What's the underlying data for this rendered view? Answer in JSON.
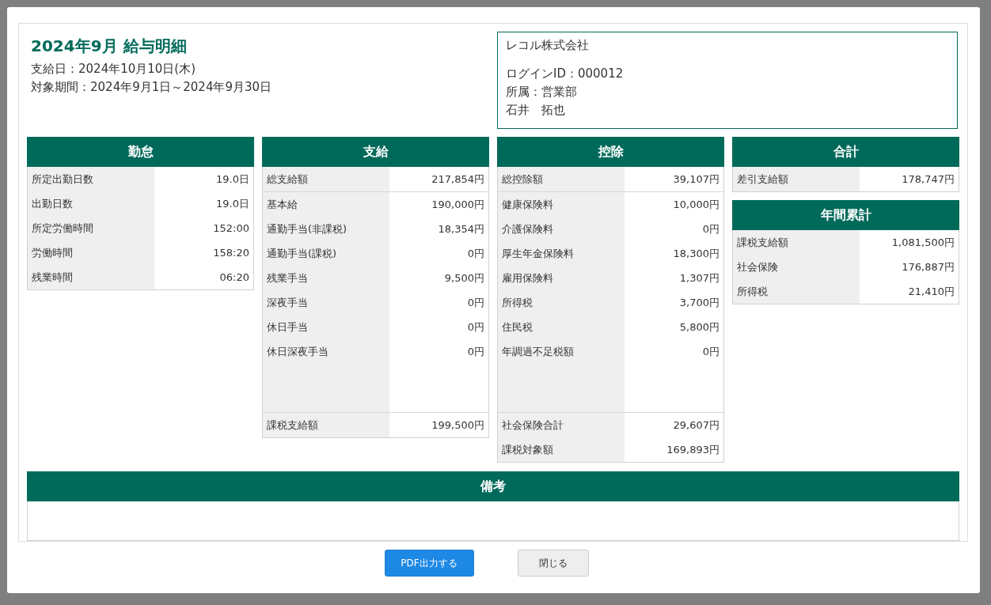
{
  "title": "2024年9月 給与明細",
  "pay_date": "支給日：2024年10月10日(木)",
  "period": "対象期間：2024年9月1日～2024年9月30日",
  "employee": {
    "company": "レコル株式会社",
    "login_id": "ログインID：000012",
    "department": "所属：営業部",
    "name": "石井　拓也"
  },
  "columns": [
    [
      {
        "title": "勤怠",
        "groups": [
          [
            {
              "label": "所定出勤日数",
              "value": "19.0日"
            },
            {
              "label": "出勤日数",
              "value": "19.0日"
            },
            {
              "label": "所定労働時間",
              "value": "152:00"
            },
            {
              "label": "労働時間",
              "value": "158:20"
            },
            {
              "label": "残業時間",
              "value": "06:20"
            }
          ]
        ]
      }
    ],
    [
      {
        "title": "支給",
        "groups": [
          [
            {
              "label": "総支給額",
              "value": "217,854円"
            }
          ],
          [
            {
              "label": "基本給",
              "value": "190,000円"
            },
            {
              "label": "通勤手当(非課税)",
              "value": "18,354円"
            },
            {
              "label": "通勤手当(課税)",
              "value": "0円"
            },
            {
              "label": "残業手当",
              "value": "9,500円"
            },
            {
              "label": "深夜手当",
              "value": "0円"
            },
            {
              "label": "休日手当",
              "value": "0円"
            },
            {
              "label": "休日深夜手当",
              "value": "0円"
            }
          ],
          [
            {
              "label": "課税支給額",
              "value": "199,500円"
            }
          ]
        ]
      }
    ],
    [
      {
        "title": "控除",
        "groups": [
          [
            {
              "label": "総控除額",
              "value": "39,107円"
            }
          ],
          [
            {
              "label": "健康保険料",
              "value": "10,000円"
            },
            {
              "label": "介護保険料",
              "value": "0円"
            },
            {
              "label": "厚生年金保険料",
              "value": "18,300円"
            },
            {
              "label": "雇用保険料",
              "value": "1,307円"
            },
            {
              "label": "所得税",
              "value": "3,700円"
            },
            {
              "label": "住民税",
              "value": "5,800円"
            },
            {
              "label": "年調過不足税額",
              "value": "0円"
            }
          ],
          [
            {
              "label": "社会保険合計",
              "value": "29,607円"
            },
            {
              "label": "課税対象額",
              "value": "169,893円"
            }
          ]
        ]
      }
    ],
    [
      {
        "title": "合計",
        "groups": [
          [
            {
              "label": "差引支給額",
              "value": "178,747円"
            }
          ]
        ]
      },
      {
        "title": "年間累計",
        "groups": [
          [
            {
              "label": "課税支給額",
              "value": "1,081,500円"
            },
            {
              "label": "社会保険",
              "value": "176,887円"
            },
            {
              "label": "所得税",
              "value": "21,410円"
            }
          ]
        ]
      }
    ]
  ],
  "remarks": {
    "title": "備考"
  },
  "buttons": [
    {
      "label": "PDF出力する",
      "kind": "primary"
    },
    {
      "label": "閉じる",
      "kind": "secondary"
    }
  ]
}
